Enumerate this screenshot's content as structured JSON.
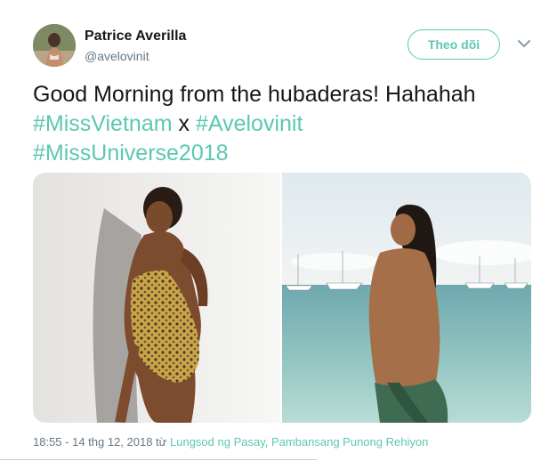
{
  "user": {
    "display_name": "Patrice Averilla",
    "handle": "@avelovinit"
  },
  "follow_button": {
    "label": "Theo dõi"
  },
  "tweet": {
    "lead": "Good Morning from the hubaderas! Hahahah",
    "hashtag_1": "#MissVietnam",
    "connector": "x",
    "hashtag_2": "#Avelovinit",
    "hashtag_3": "#MissUniverse2018"
  },
  "meta": {
    "timestamp": "18:55 - 14 thg 12, 2018 từ",
    "location": "Lungsod ng Pasay, Pambansang Punong Rehiyon"
  },
  "icons": {
    "more": "chevron-down-icon"
  },
  "colors": {
    "accent": "#5bc8b0",
    "secondary_text": "#657786",
    "text": "#14171a"
  }
}
